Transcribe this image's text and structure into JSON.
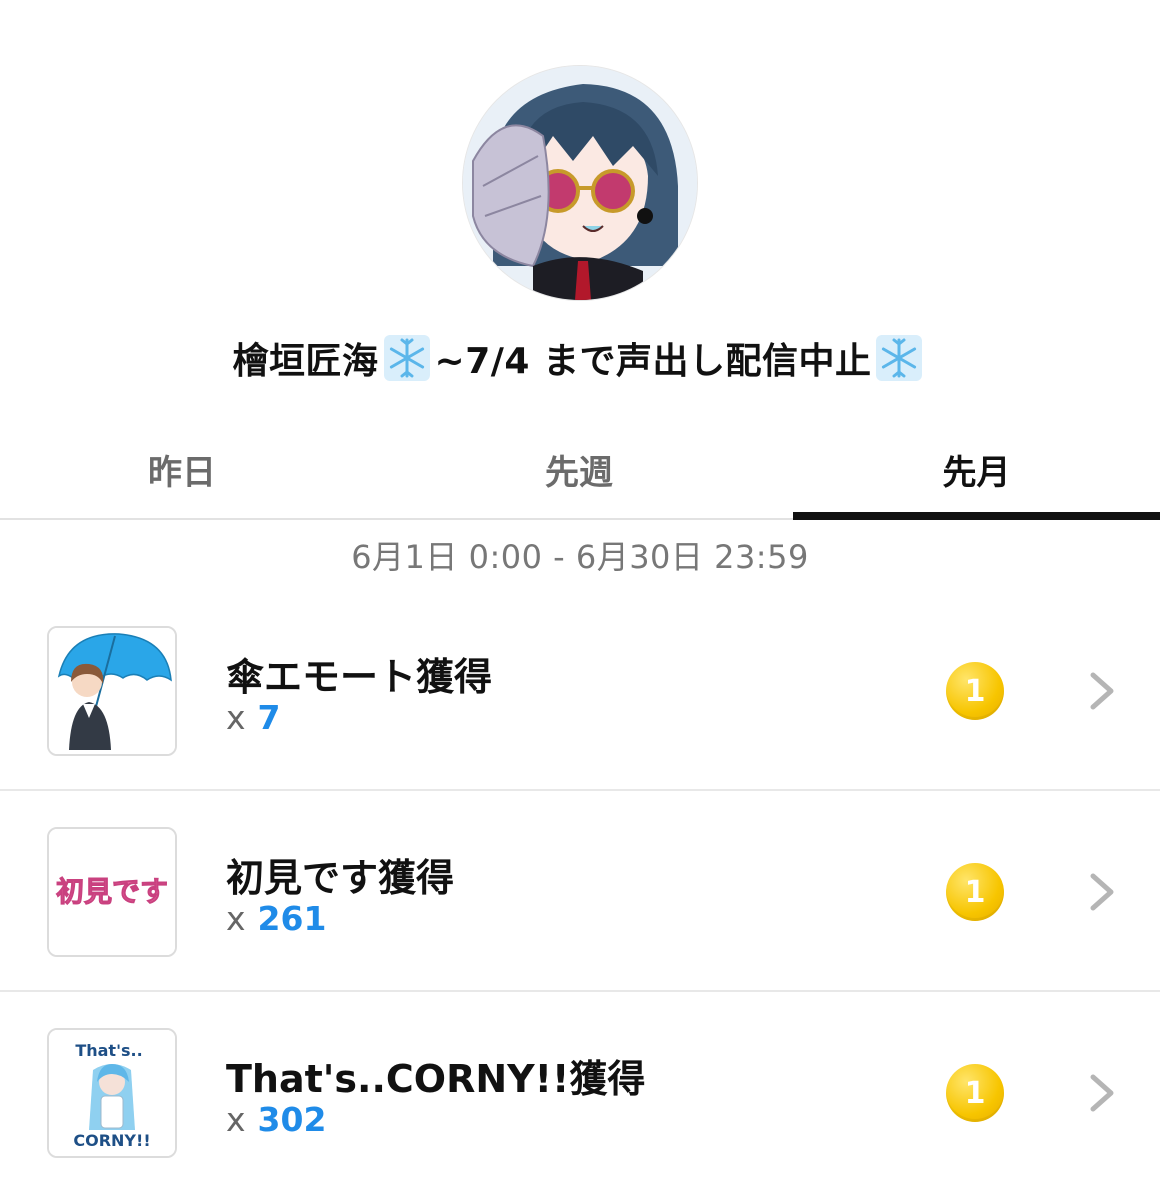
{
  "profile": {
    "name_part1": "檜垣匠海",
    "name_part2": "~7/4 まで声出し配信中止",
    "snow_icon": "snowflake-icon"
  },
  "tabs": [
    {
      "label": "昨日",
      "active": false
    },
    {
      "label": "先週",
      "active": false
    },
    {
      "label": "先月",
      "active": true
    }
  ],
  "date_range": "6月1日 0:00 - 6月30日 23:59",
  "items": [
    {
      "title": "傘エモート獲得",
      "count_prefix": "x",
      "count": "7",
      "rank": "1",
      "thumb": "umbrella-girl"
    },
    {
      "title": "初見です獲得",
      "count_prefix": "x",
      "count": "261",
      "rank": "1",
      "thumb": "hatsumi-desu",
      "thumb_text": "初見です"
    },
    {
      "title": "That's..CORNY!!獲得",
      "count_prefix": "x",
      "count": "302",
      "rank": "1",
      "thumb": "thats-corny",
      "thumb_text_top": "That's..",
      "thumb_text_bottom": "CORNY!!"
    }
  ],
  "colors": {
    "accent_blue": "#1f8be8",
    "badge_gold": "#f7c500",
    "active_tab": "#111111",
    "inactive_tab": "#6b6b6b"
  }
}
